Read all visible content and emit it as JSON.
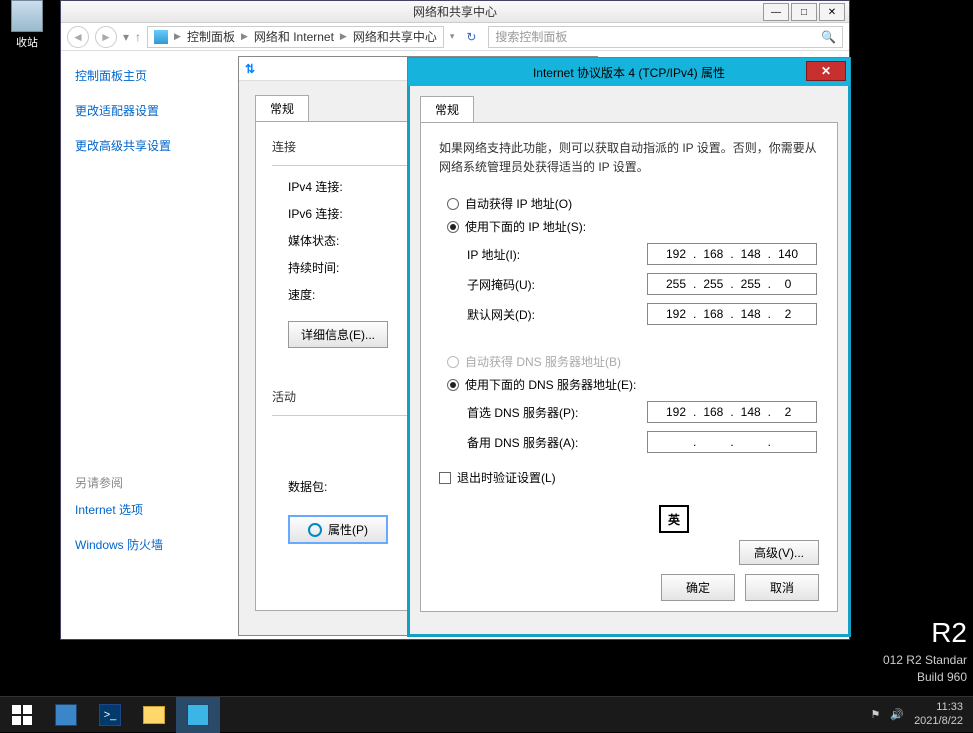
{
  "desktop": {
    "recycle_bin": "收站"
  },
  "bgwin": {
    "title": "网络和共享中心",
    "breadcrumb": [
      "控制面板",
      "网络和 Internet",
      "网络和共享中心"
    ],
    "search_placeholder": "搜索控制面板",
    "leftnav": {
      "home": "控制面板主页",
      "adapter": "更改适配器设置",
      "sharing": "更改高级共享设置",
      "seealso_title": "另请参阅",
      "internet_options": "Internet 选项",
      "firewall": "Windows 防火墙"
    }
  },
  "midwin": {
    "tab": "常规",
    "group_conn": "连接",
    "ipv4": "IPv4 连接:",
    "ipv6": "IPv6 连接:",
    "media": "媒体状态:",
    "duration": "持续时间:",
    "speed": "速度:",
    "details_btn": "详细信息(E)...",
    "group_activity": "活动",
    "packets": "数据包:",
    "properties_btn": "属性(P)"
  },
  "frontwin": {
    "title": "Internet 协议版本 4 (TCP/IPv4) 属性",
    "tab": "常规",
    "help": "如果网络支持此功能，则可以获取自动指派的 IP 设置。否则，你需要从网络系统管理员处获得适当的 IP 设置。",
    "auto_ip": "自动获得 IP 地址(O)",
    "use_ip": "使用下面的 IP 地址(S):",
    "ip_label": "IP 地址(I):",
    "ip_value": [
      "192",
      "168",
      "148",
      "140"
    ],
    "mask_label": "子网掩码(U):",
    "mask_value": [
      "255",
      "255",
      "255",
      "0"
    ],
    "gw_label": "默认网关(D):",
    "gw_value": [
      "192",
      "168",
      "148",
      "2"
    ],
    "auto_dns": "自动获得 DNS 服务器地址(B)",
    "use_dns": "使用下面的 DNS 服务器地址(E):",
    "dns1_label": "首选 DNS 服务器(P):",
    "dns1_value": [
      "192",
      "168",
      "148",
      "2"
    ],
    "dns2_label": "备用 DNS 服务器(A):",
    "dns2_value": [
      "",
      "",
      "",
      ""
    ],
    "validate": "退出时验证设置(L)",
    "advanced": "高级(V)...",
    "ok": "确定",
    "cancel": "取消",
    "ime": "英"
  },
  "watermark": {
    "line1": "R2",
    "line2": "012 R2 Standar",
    "line3": "Build 960"
  },
  "taskbar": {
    "time": "11:33",
    "date": "2021/8/22"
  }
}
